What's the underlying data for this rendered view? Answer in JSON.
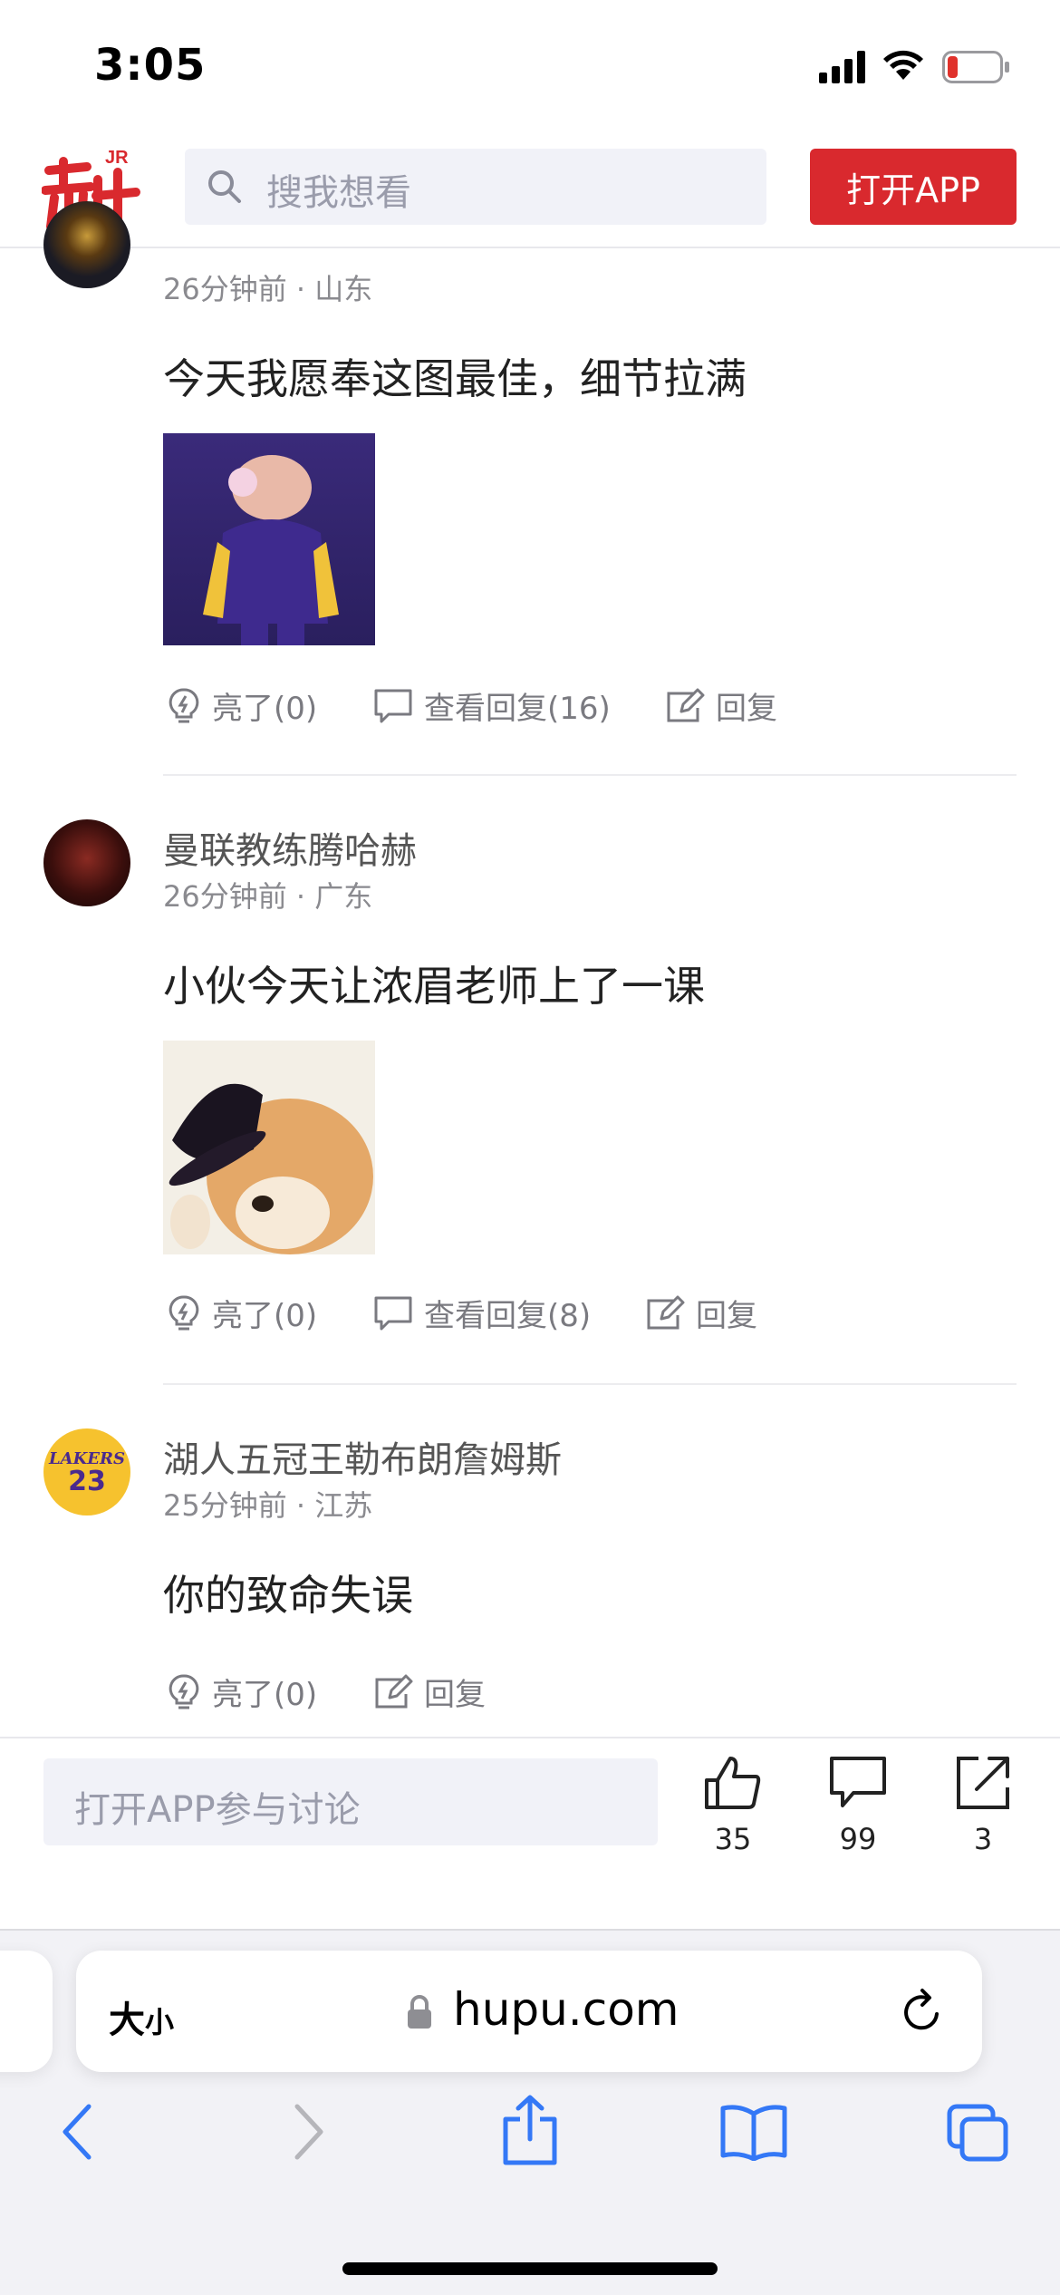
{
  "status_bar": {
    "time": "3:05"
  },
  "header": {
    "logo_label": "JR",
    "search_placeholder": "搜我想看",
    "open_app_label": "打开APP"
  },
  "comments": [
    {
      "username": "",
      "time": "26分钟前",
      "location": "山东",
      "content": "今天我愿奉这图最佳，细节拉满",
      "image": "pig-basketball-image",
      "actions": {
        "light": "亮了(0)",
        "view_replies": "查看回复(16)",
        "reply": "回复"
      }
    },
    {
      "username": "曼联教练腾哈赫",
      "time": "26分钟前",
      "location": "广东",
      "content": "小伙今天让浓眉老师上了一课",
      "image": "shiba-hat-image",
      "actions": {
        "light": "亮了(0)",
        "view_replies": "查看回复(8)",
        "reply": "回复"
      }
    },
    {
      "username": "湖人五冠王勒布朗詹姆斯",
      "time": "25分钟前",
      "location": "江苏",
      "content": "你的致命失误",
      "avatar_text": "LAKERS",
      "avatar_number": "23",
      "actions": {
        "light": "亮了(0)",
        "reply": "回复"
      }
    }
  ],
  "bottom_bar": {
    "discuss_placeholder": "打开APP参与讨论",
    "likes": "35",
    "comments": "99",
    "shares": "3"
  },
  "safari": {
    "text_size_label": "大",
    "text_size_small": "小",
    "url": "hupu.com"
  },
  "colors": {
    "brand_red": "#d9292e",
    "safari_blue": "#3478f6"
  }
}
